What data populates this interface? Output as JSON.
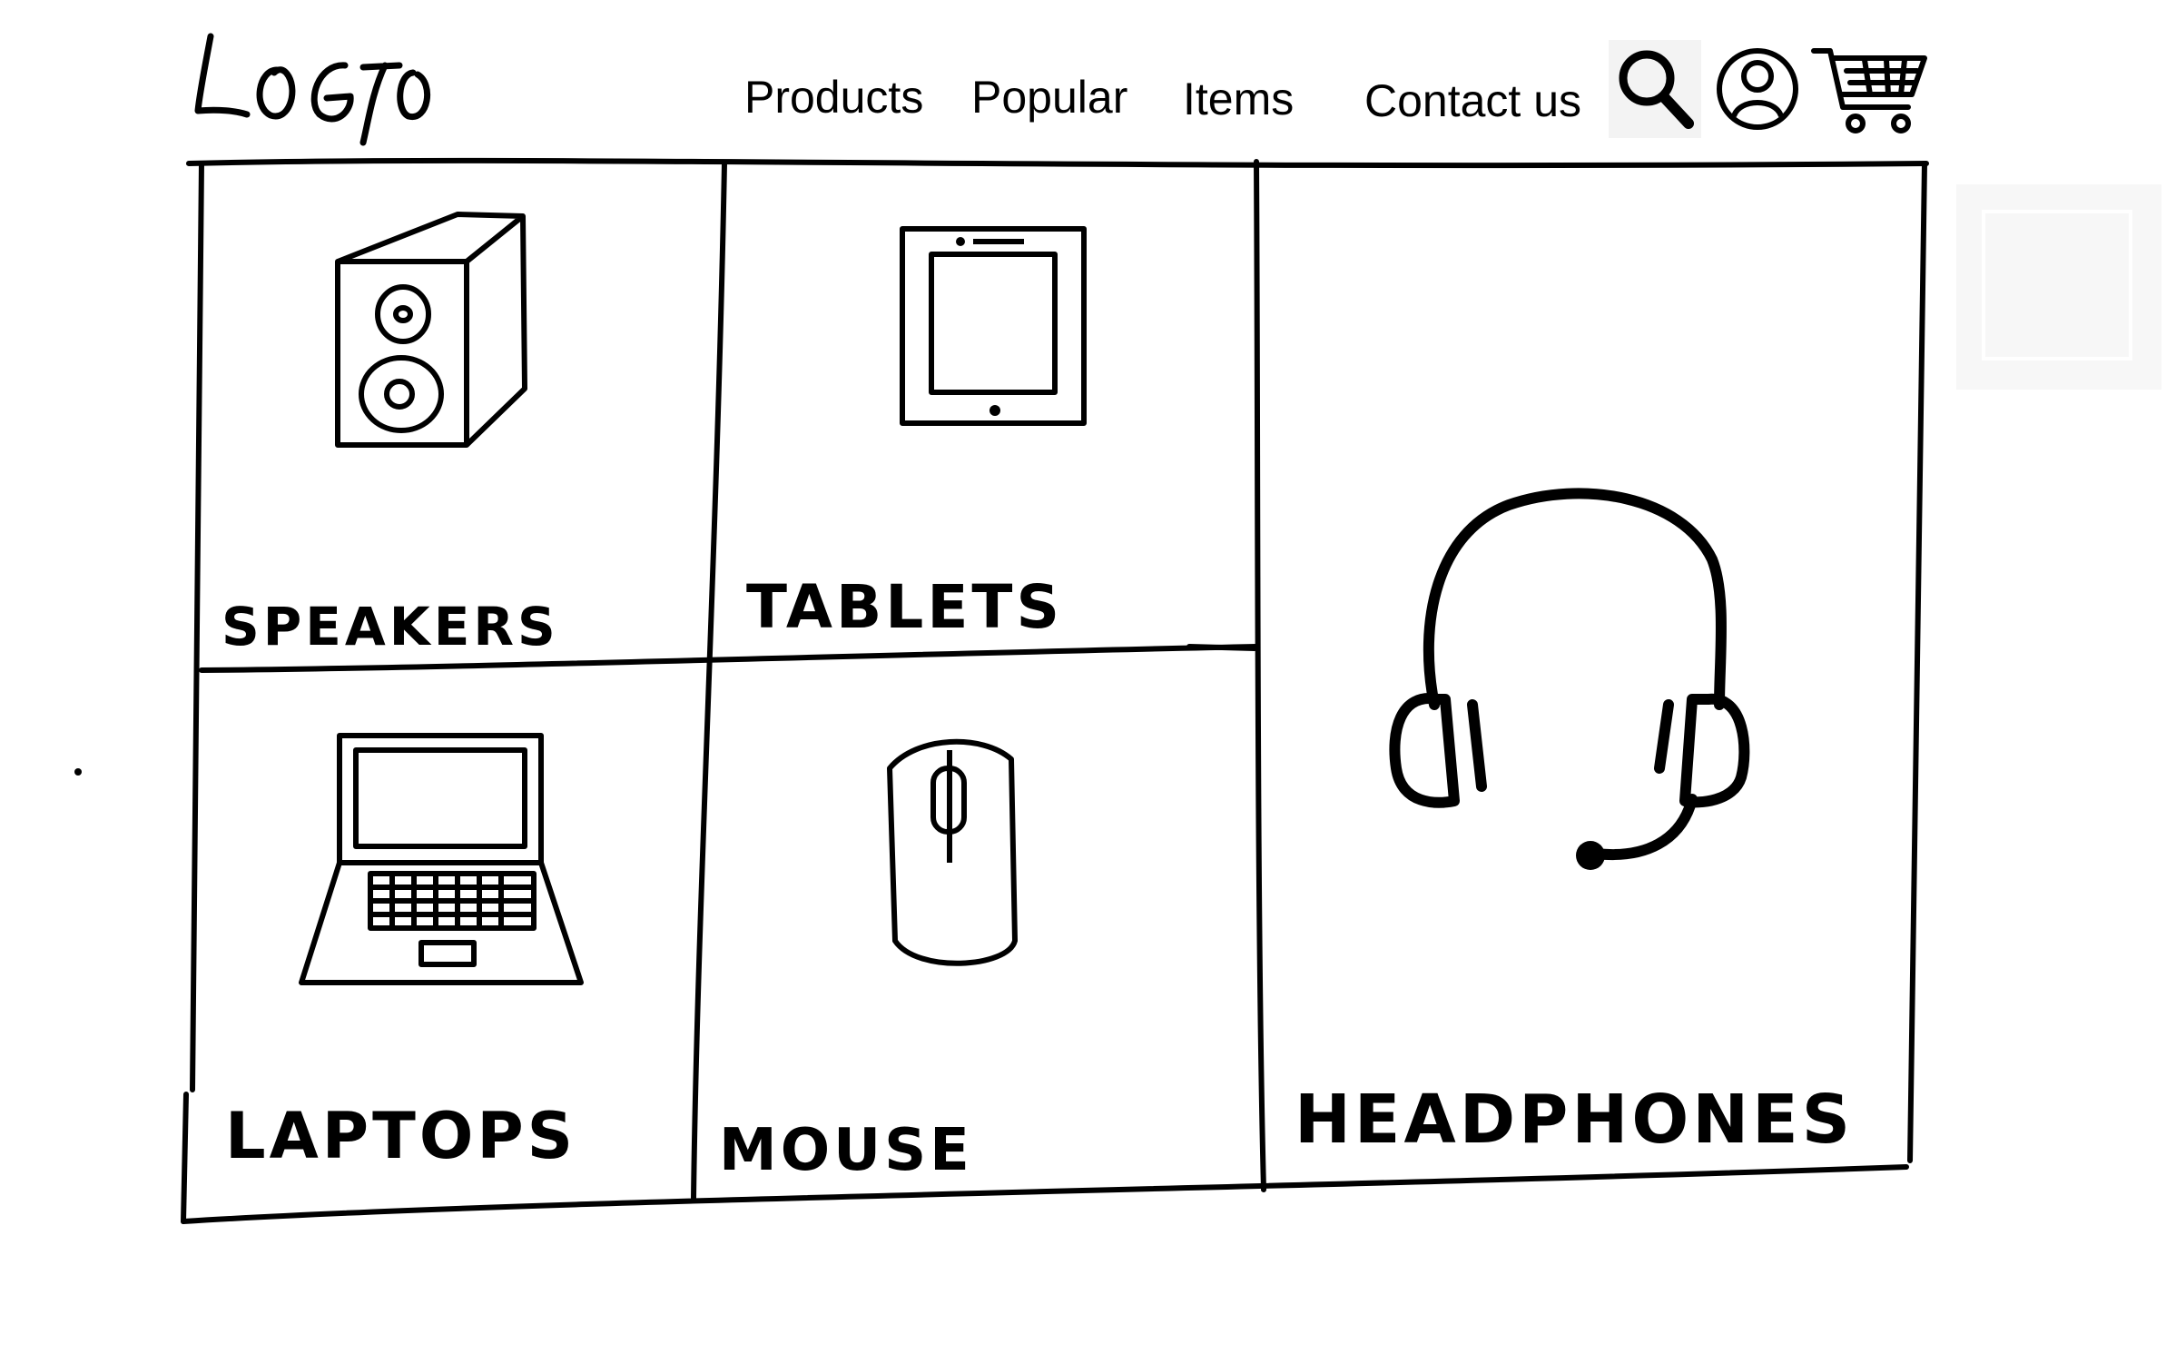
{
  "header": {
    "logo_text": "LOGO",
    "nav": [
      {
        "label": "Products"
      },
      {
        "label": "Popular"
      },
      {
        "label": "Items"
      },
      {
        "label": "Contact us"
      }
    ],
    "icons": [
      "search-icon",
      "user-icon",
      "cart-icon"
    ]
  },
  "categories": [
    {
      "label": "SPEAKERS",
      "icon": "speaker-icon"
    },
    {
      "label": "TABLETS",
      "icon": "tablet-icon"
    },
    {
      "label": "LAPTOPS",
      "icon": "laptop-icon"
    },
    {
      "label": "MOUSE",
      "icon": "mouse-icon"
    },
    {
      "label": "HEADPHONES",
      "icon": "headphones-icon"
    }
  ],
  "colors": {
    "ink": "#000000",
    "background": "#ffffff",
    "icon_bg": "#f3f3f3"
  }
}
